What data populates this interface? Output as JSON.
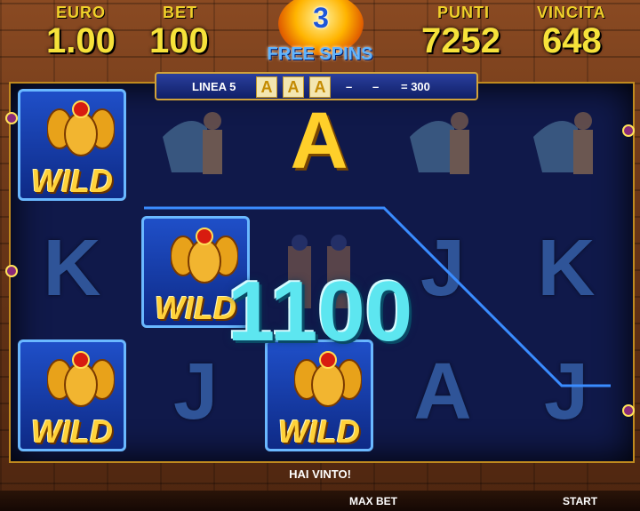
{
  "hud": {
    "euro_label": "EURO",
    "euro_value": "1.00",
    "bet_label": "BET",
    "bet_value": "100",
    "points_label": "PUNTI",
    "points_value": "7252",
    "win_label": "VINCITA",
    "win_value": "648"
  },
  "free_spins": {
    "count": "3",
    "label": "FREE SPINS"
  },
  "payline": {
    "line_label": "LINEA 5",
    "symbols": [
      "A",
      "A",
      "A"
    ],
    "dash1": "–",
    "dash2": "–",
    "result": "= 300"
  },
  "reels": [
    [
      "WILD",
      "K",
      "WILD"
    ],
    [
      "egyptian-woman",
      "WILD",
      "J"
    ],
    [
      "A",
      "pharaoh-pair",
      "WILD"
    ],
    [
      "egyptian-woman",
      "J",
      "A"
    ],
    [
      "egyptian-woman",
      "K",
      "J"
    ]
  ],
  "wild_text": "WILD",
  "win_amount": "1100",
  "status_message": "HAI VINTO!",
  "controls": {
    "max_bet": "MAX BET",
    "start": "START"
  },
  "colors": {
    "hud_text": "#f6e23a",
    "win_amount": "#5de6f0",
    "frame": "#c08a1e",
    "reel_bg": "#10194a"
  }
}
